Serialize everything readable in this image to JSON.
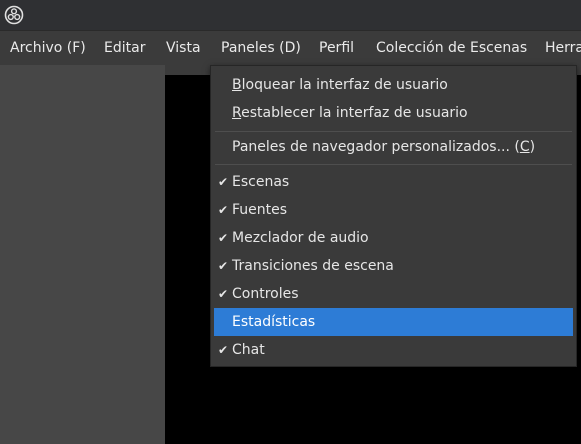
{
  "titlebar": {
    "icon": "obs-logo-icon"
  },
  "menubar": {
    "items": [
      {
        "label": "Archivo (F)"
      },
      {
        "label": "Editar"
      },
      {
        "label": "Vista"
      },
      {
        "label": "Paneles (D)"
      },
      {
        "label": "Perfil"
      },
      {
        "label": "Colección de Escenas"
      },
      {
        "label": "Herra"
      }
    ]
  },
  "dropdown": {
    "lock_ui": {
      "first": "B",
      "rest": "loquear la interfaz de usuario"
    },
    "reset_ui": {
      "first": "R",
      "rest": "establecer la interfaz de usuario"
    },
    "custom_browser": {
      "prefix": "Paneles de navegador personalizados... (",
      "key": "C",
      "suffix": ")"
    },
    "docks": [
      {
        "label": "Escenas",
        "checked": true
      },
      {
        "label": "Fuentes",
        "checked": true
      },
      {
        "label": "Mezclador de audio",
        "checked": true
      },
      {
        "label": "Transiciones de escena",
        "checked": true
      },
      {
        "label": "Controles",
        "checked": true
      },
      {
        "label": "Estadísticas",
        "checked": false,
        "highlighted": true
      },
      {
        "label": "Chat",
        "checked": true
      }
    ],
    "check_glyph": "✔",
    "highlight_color": "#2d7cd6"
  }
}
